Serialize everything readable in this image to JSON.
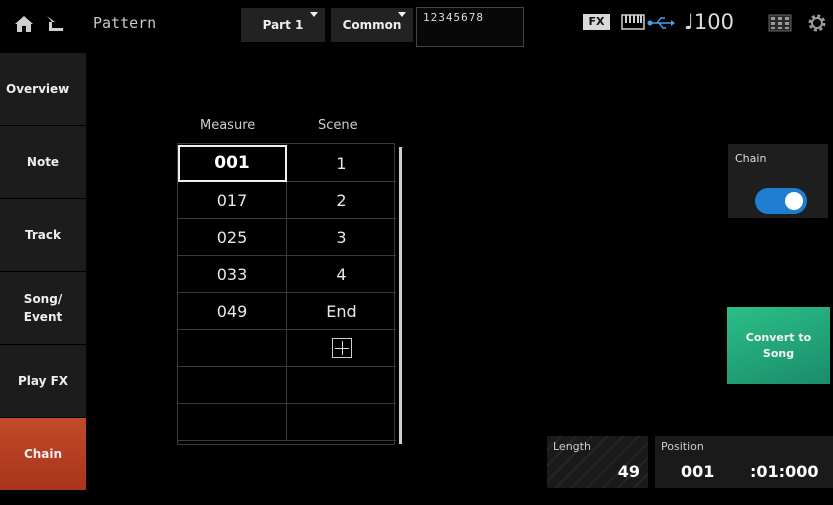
{
  "header": {
    "title": "Pattern",
    "part_button": "Part 1",
    "common_button": "Common",
    "part_numbers": "12345678",
    "fx_badge": "FX",
    "tempo": "♩100"
  },
  "sidebar": {
    "items": [
      {
        "label": "Overview",
        "active": false
      },
      {
        "label": "Note",
        "active": false
      },
      {
        "label": "Track",
        "active": false
      },
      {
        "label": "Song/\nEvent",
        "active": false
      },
      {
        "label": "Play FX",
        "active": false
      },
      {
        "label": "Chain",
        "active": true
      }
    ]
  },
  "table": {
    "headers": {
      "measure": "Measure",
      "scene": "Scene"
    },
    "rows": [
      {
        "measure": "001",
        "scene": "1"
      },
      {
        "measure": "017",
        "scene": "2"
      },
      {
        "measure": "025",
        "scene": "3"
      },
      {
        "measure": "033",
        "scene": "4"
      },
      {
        "measure": "049",
        "scene": "End"
      },
      {
        "measure": "",
        "scene": ""
      },
      {
        "measure": "",
        "scene": ""
      },
      {
        "measure": "",
        "scene": ""
      }
    ],
    "selected_row": 0
  },
  "chain": {
    "label": "Chain",
    "enabled": true,
    "color": "#1e7fd2"
  },
  "convert_button": {
    "label": "Convert to\nSong",
    "color": "#2bbf88"
  },
  "length": {
    "label": "Length",
    "value": "49"
  },
  "position": {
    "label": "Position",
    "measure": "001",
    "beat": ":01:000"
  },
  "colors": {
    "active_tab": "#c24a2a"
  }
}
